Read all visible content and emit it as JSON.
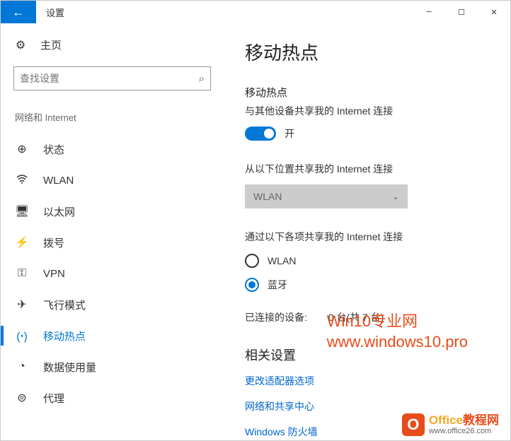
{
  "titlebar": {
    "title": "设置"
  },
  "sidebar": {
    "home": "主页",
    "search_placeholder": "查找设置",
    "category": "网络和 Internet",
    "items": [
      {
        "icon": "status",
        "label": "状态"
      },
      {
        "icon": "wlan",
        "label": "WLAN"
      },
      {
        "icon": "ethernet",
        "label": "以太网"
      },
      {
        "icon": "dialup",
        "label": "拨号"
      },
      {
        "icon": "vpn",
        "label": "VPN"
      },
      {
        "icon": "airplane",
        "label": "飞行模式"
      },
      {
        "icon": "hotspot",
        "label": "移动热点"
      },
      {
        "icon": "datausage",
        "label": "数据使用量"
      },
      {
        "icon": "proxy",
        "label": "代理"
      }
    ]
  },
  "main": {
    "title": "移动热点",
    "hotspot_label": "移动热点",
    "hotspot_desc": "与其他设备共享我的 Internet 连接",
    "toggle_state": "开",
    "share_from_label": "从以下位置共享我的 Internet 连接",
    "share_from_value": "WLAN",
    "share_via_label": "通过以下各项共享我的 Internet 连接",
    "radio_wlan": "WLAN",
    "radio_bt": "蓝牙",
    "connected_label": "已连接的设备:",
    "connected_count": "0 台(共 7 台)",
    "related_title": "相关设置",
    "links": [
      "更改适配器选项",
      "网络和共享中心",
      "Windows 防火墙"
    ]
  },
  "watermark": {
    "w1_line1": "Win10专业网",
    "w1_line2": "www.windows10.pro",
    "w2_brand": "Office",
    "w2_suffix": "教程网",
    "w2_url": "www.office26.com"
  }
}
